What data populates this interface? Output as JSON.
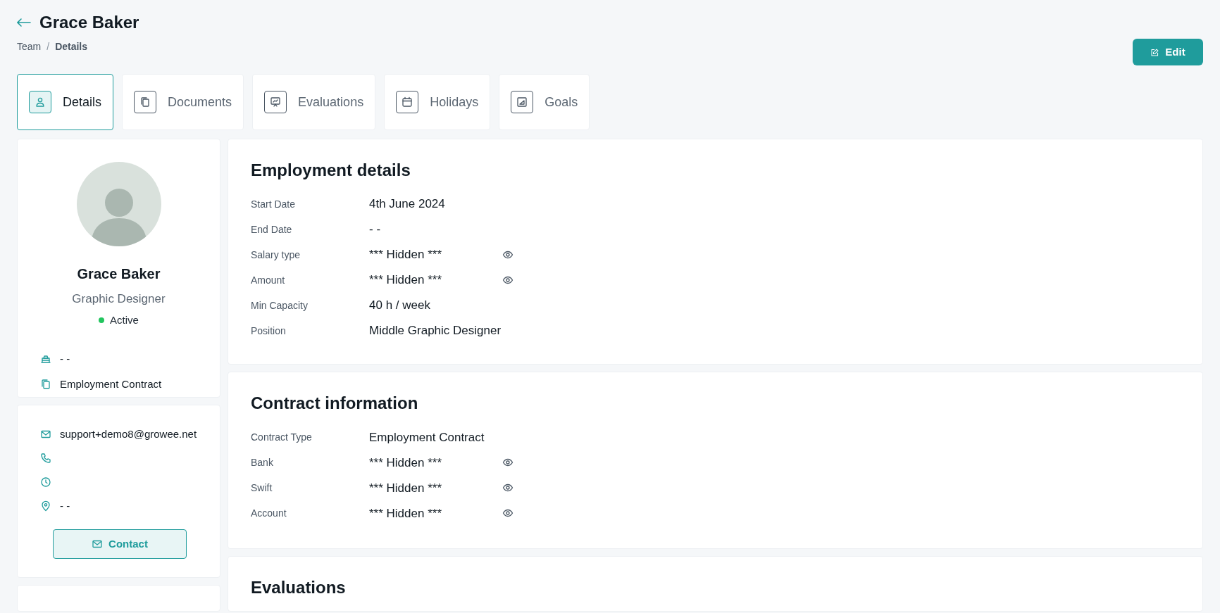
{
  "header": {
    "title": "Grace Baker",
    "breadcrumb": [
      "Team",
      "Details"
    ],
    "breadcrumb_separator": "/",
    "edit_button": "Edit"
  },
  "tabs": [
    {
      "label": "Details",
      "kind": "person",
      "selected": true
    },
    {
      "label": "Documents",
      "kind": "files",
      "selected": false
    },
    {
      "label": "Evaluations",
      "kind": "board",
      "selected": false
    },
    {
      "label": "Holidays",
      "kind": "calendar",
      "selected": false
    },
    {
      "label": "Goals",
      "kind": "chart",
      "selected": false
    }
  ],
  "profile": {
    "name": "Grace Baker",
    "job_title": "Graphic Designer",
    "status": {
      "label": "Active",
      "color": "#22c55e"
    },
    "info": [
      {
        "kind": "cake",
        "text": "- -"
      },
      {
        "kind": "files",
        "text": "Employment Contract"
      }
    ]
  },
  "contact": {
    "items": [
      {
        "kind": "mail",
        "text": "support+demo8@growee.net"
      },
      {
        "kind": "phone"
      },
      {
        "kind": "clock"
      },
      {
        "kind": "pin",
        "text": "- -"
      }
    ],
    "button": "Contact"
  },
  "sections": [
    {
      "title": "Employment details",
      "rows": [
        {
          "label": "Start Date",
          "value": "4th June 2024",
          "kind": "plain"
        },
        {
          "label": "End Date",
          "value": "- -",
          "kind": "plain"
        },
        {
          "label": "Salary type",
          "value": "*** Hidden ***",
          "kind": "hidden"
        },
        {
          "label": "Amount",
          "value": "*** Hidden ***",
          "kind": "hidden"
        },
        {
          "label": "Min Capacity",
          "value": "40 h / week",
          "kind": "plain"
        },
        {
          "label": "Position",
          "value": "Middle Graphic Designer",
          "kind": "plain"
        }
      ]
    },
    {
      "title": "Contract information",
      "rows": [
        {
          "label": "Contract Type",
          "value": "Employment Contract",
          "kind": "plain"
        },
        {
          "label": "Bank",
          "value": "*** Hidden ***",
          "kind": "hidden"
        },
        {
          "label": "Swift",
          "value": "*** Hidden ***",
          "kind": "hidden"
        },
        {
          "label": "Account",
          "value": "*** Hidden ***",
          "kind": "hidden"
        }
      ]
    },
    {
      "title": "Evaluations"
    }
  ]
}
